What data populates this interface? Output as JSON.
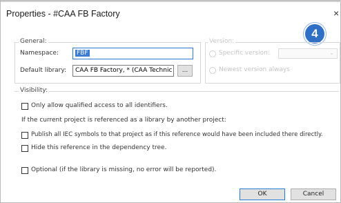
{
  "window": {
    "title": "Properties - #CAA FB Factory",
    "close_glyph": "×",
    "badge_number": "4"
  },
  "general": {
    "section_label": "General:",
    "namespace_label": "Namespace:",
    "namespace_value": "FBF",
    "default_library_label": "Default library:",
    "default_library_value": "CAA FB Factory, * (CAA Technic",
    "browse_label": "..."
  },
  "version": {
    "section_label": "Version:",
    "specific_label": "Specific version:",
    "newest_label": "Newest version always"
  },
  "visibility": {
    "section_label": "Visibility:",
    "qualified_label": "Only allow qualified access to all identifiers.",
    "referenced_note": "If the current project is referenced as a library by another project:",
    "publish_label": "Publish all IEC symbols to that project as if this reference would have been included there directly.",
    "hide_label": "Hide this reference in the dependency tree."
  },
  "optional": {
    "label": "Optional (if the library is missing, no error will be reported)."
  },
  "buttons": {
    "ok": "OK",
    "cancel": "Cancel"
  },
  "colors": {
    "badge": "#2f6fc6",
    "selection": "#3a7bd5",
    "focus_border": "#2a7bd6"
  }
}
